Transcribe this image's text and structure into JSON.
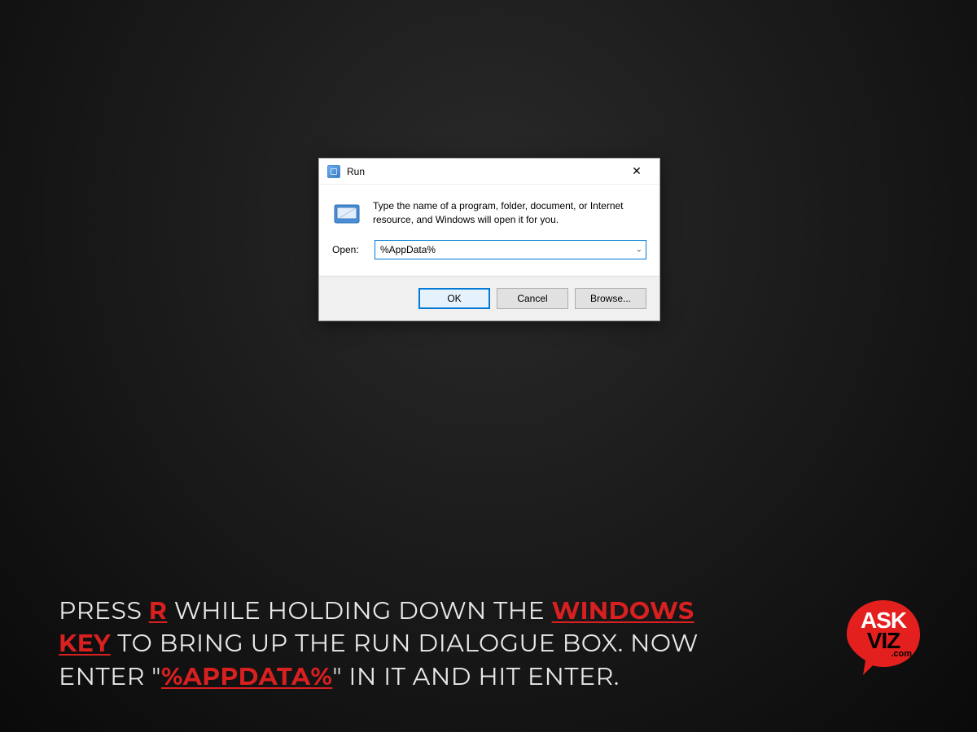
{
  "dialog": {
    "title": "Run",
    "description": "Type the name of a program, folder, document, or Internet resource, and Windows will open it for you.",
    "open_label": "Open:",
    "open_value": "%AppData%",
    "buttons": {
      "ok": "OK",
      "cancel": "Cancel",
      "browse": "Browse..."
    }
  },
  "caption": {
    "p1": "PRESS ",
    "r": "R",
    "p2": " WHILE HOLDING DOWN THE ",
    "winkey": "WINDOWS KEY",
    "p3": " TO BRING UP THE RUN DIALOGUE BOX. NOW ENTER \"",
    "appdata": "%APPDATA%",
    "p4": "\" IN IT AND HIT ENTER."
  },
  "logo": {
    "line1": "ASK",
    "line2": "VIZ",
    "suffix": ".com"
  }
}
